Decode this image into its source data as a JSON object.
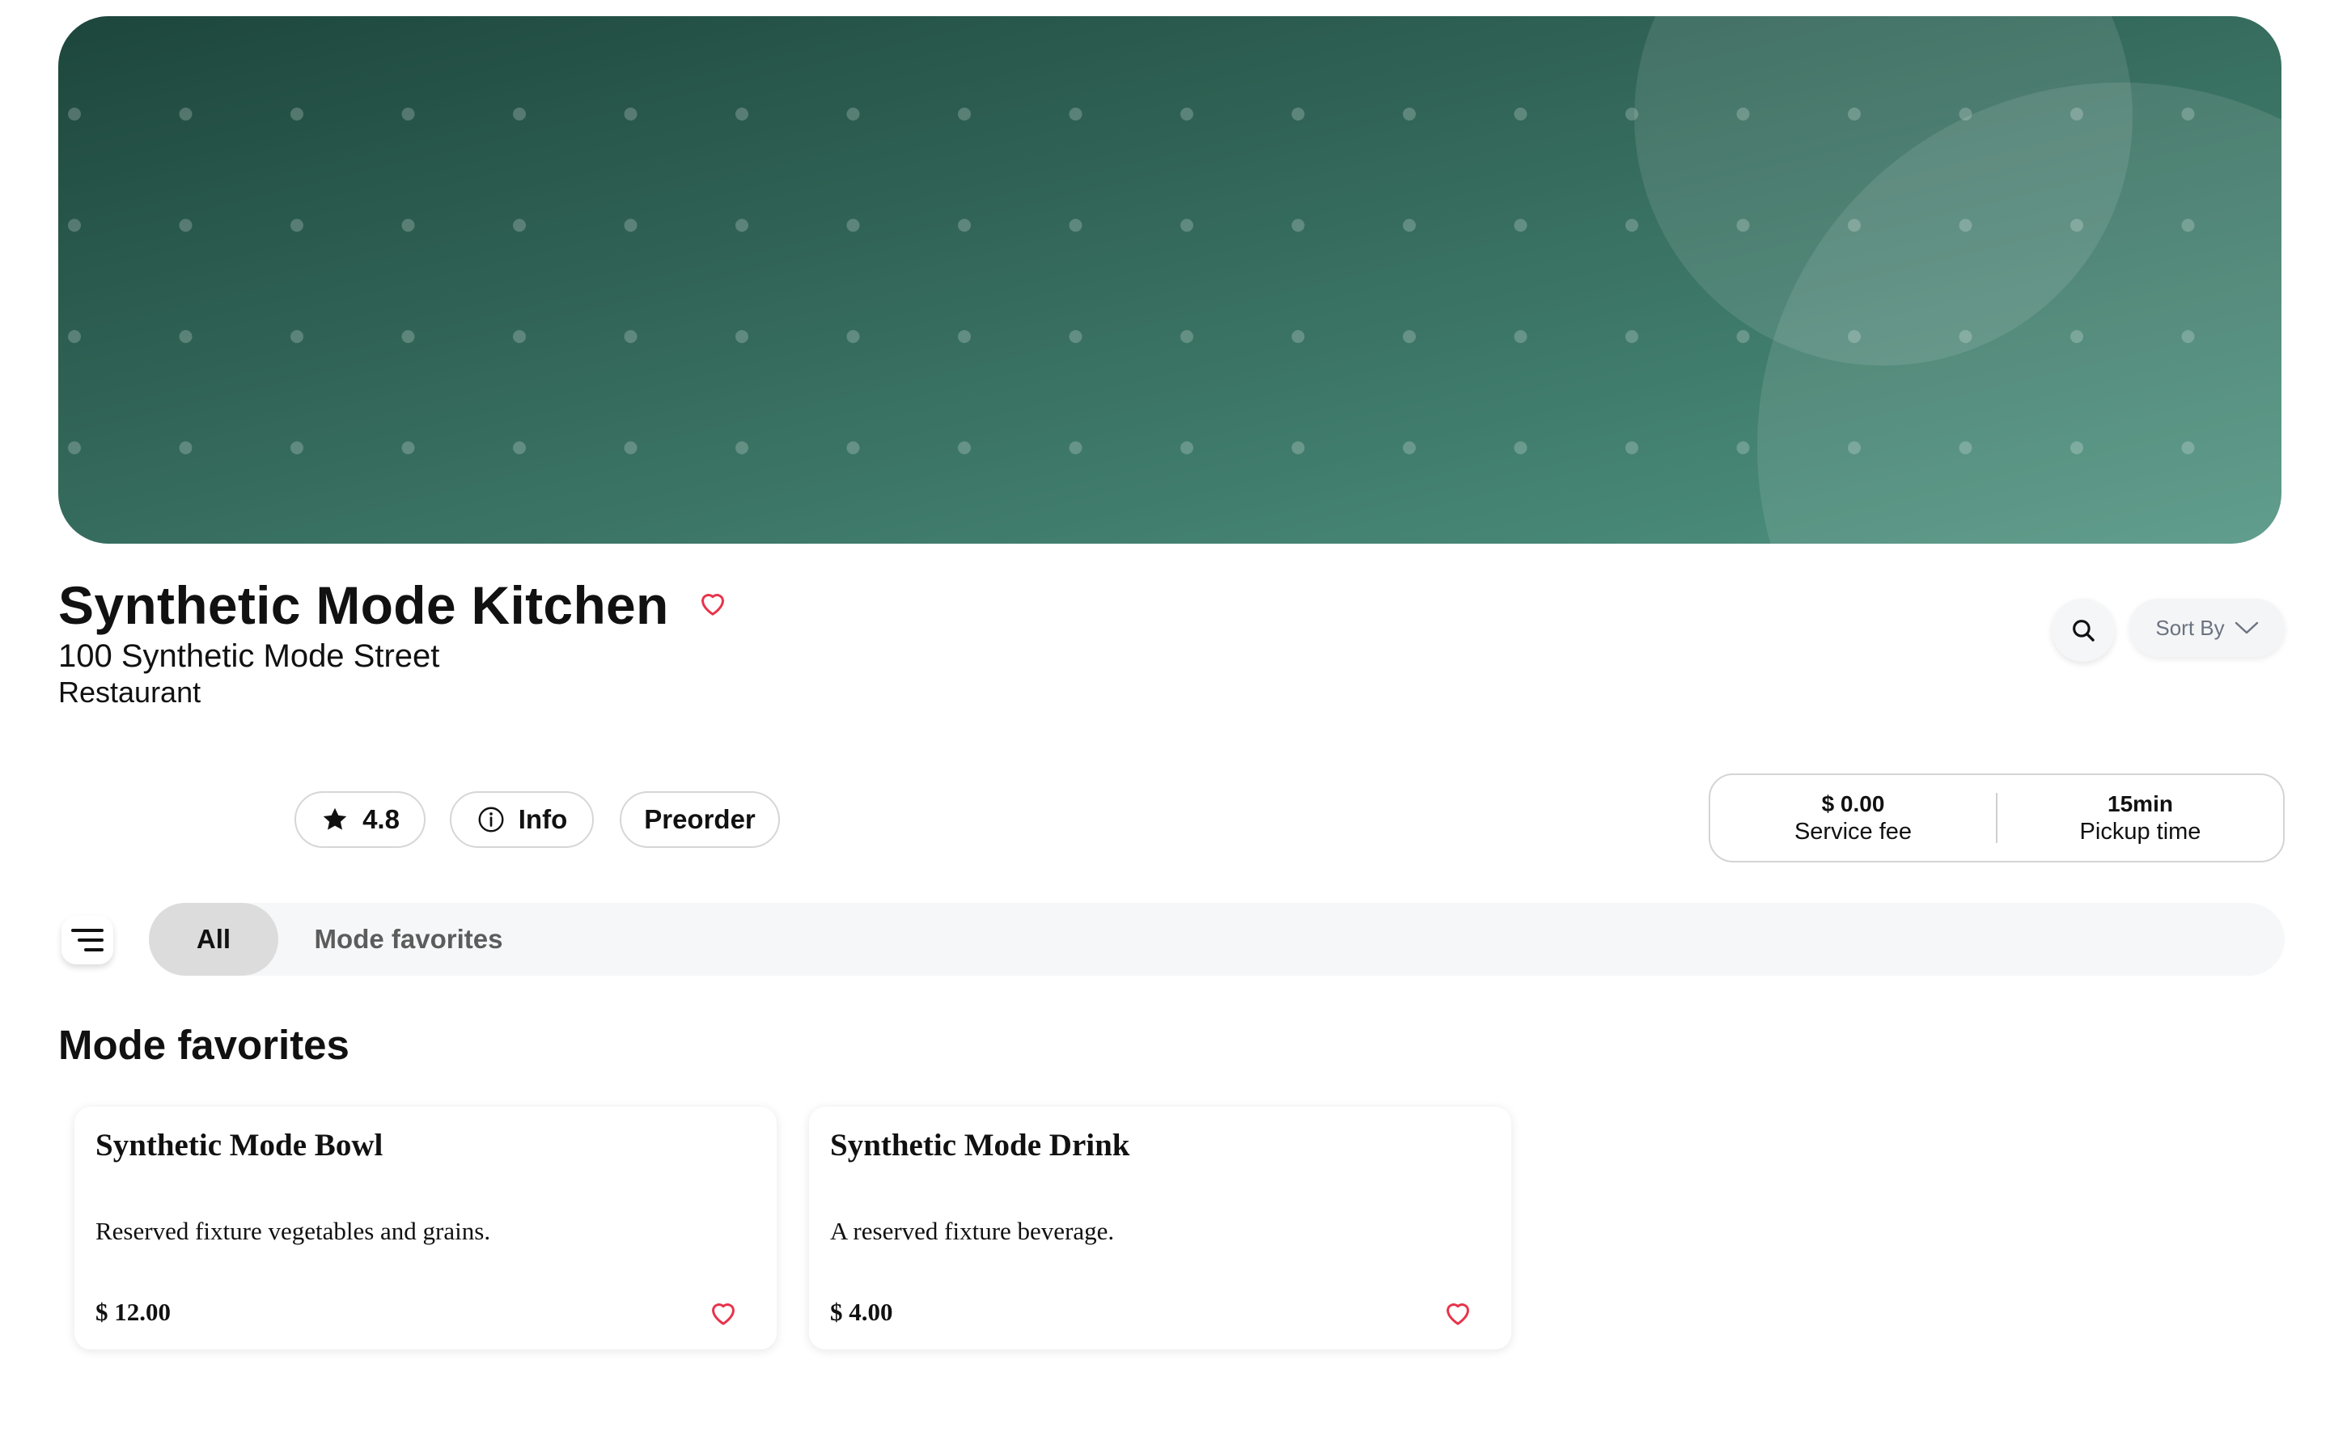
{
  "colors": {
    "hero_dark": "#1d463c",
    "hero_light": "#4f9380",
    "accent_heart": "#e8334a",
    "pill_border": "#d6d6d6",
    "tab_active_bg": "#dcdcdc",
    "tab_bar_bg": "#f6f7f8"
  },
  "restaurant": {
    "name": "Synthetic Mode Kitchen",
    "address": "100 Synthetic Mode Street",
    "type": "Restaurant",
    "favorite_icon": "heart-outline-icon"
  },
  "toolbar": {
    "search_icon": "search-icon",
    "sort_label": "Sort By",
    "sort_icon": "chevron-down-icon"
  },
  "pills": {
    "rating": "4.8",
    "rating_icon": "star-icon",
    "info_label": "Info",
    "info_icon": "info-circle-icon",
    "preorder_label": "Preorder"
  },
  "service": {
    "fee_value": "$ 0.00",
    "fee_label": "Service fee",
    "pickup_value": "15min",
    "pickup_label": "Pickup time"
  },
  "categories": {
    "menu_icon": "menu-lines-icon",
    "tabs": [
      {
        "label": "All",
        "active": true
      },
      {
        "label": "Mode favorites",
        "active": false
      }
    ]
  },
  "section": {
    "title": "Mode favorites",
    "items": [
      {
        "name": "Synthetic Mode Bowl",
        "description": "Reserved fixture vegetables and grains.",
        "price": "$ 12.00"
      },
      {
        "name": "Synthetic Mode Drink",
        "description": "A reserved fixture beverage.",
        "price": "$ 4.00"
      }
    ]
  }
}
